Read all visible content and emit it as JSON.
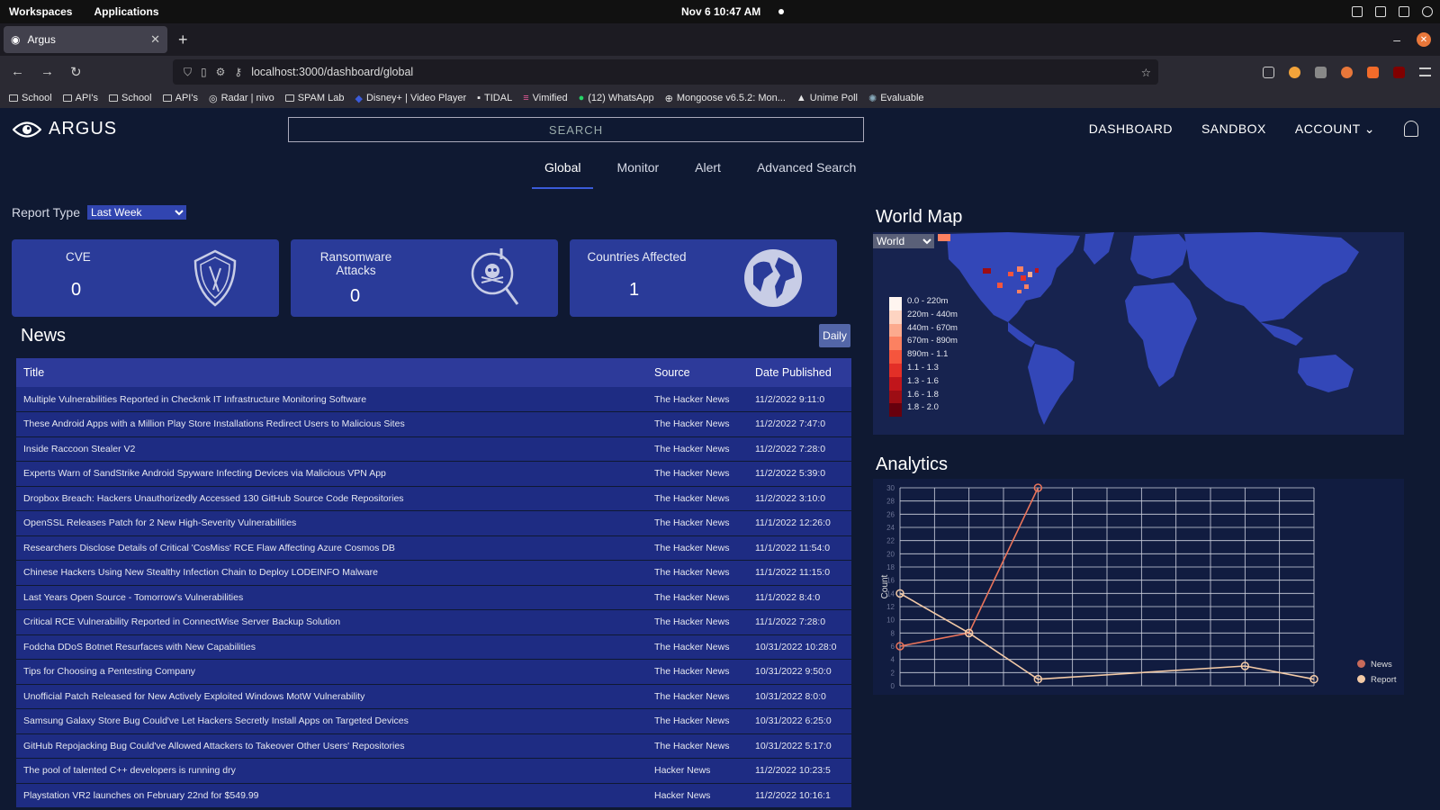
{
  "os": {
    "workspaces": "Workspaces",
    "applications": "Applications",
    "datetime": "Nov 6  10:47 AM"
  },
  "browser": {
    "tab_title": "Argus",
    "url": "localhost:3000/dashboard/global",
    "bookmarks": [
      "School",
      "API's",
      "School",
      "API's",
      "Radar | nivo",
      "SPAM Lab",
      "Disney+ | Video Player",
      "TIDAL",
      "Vimified",
      "(12) WhatsApp",
      "Mongoose v6.5.2: Mon...",
      "Unime Poll",
      "Evaluable"
    ]
  },
  "header": {
    "brand": "ARGUS",
    "search_placeholder": "SEARCH",
    "nav": {
      "dashboard": "DASHBOARD",
      "sandbox": "SANDBOX",
      "account": "ACCOUNT"
    }
  },
  "tabs": [
    "Global",
    "Monitor",
    "Alert",
    "Advanced Search"
  ],
  "report": {
    "label": "Report Type",
    "selected": "Last Week"
  },
  "cards": {
    "cve": {
      "label": "CVE",
      "value": "0"
    },
    "ransomware": {
      "label": "Ransomware Attacks",
      "value": "0"
    },
    "countries": {
      "label": "Countries Affected",
      "value": "1"
    }
  },
  "news": {
    "title": "News",
    "filter": "Daily",
    "columns": {
      "title": "Title",
      "source": "Source",
      "date": "Date Published"
    },
    "rows": [
      {
        "title": "Multiple Vulnerabilities Reported in Checkmk IT Infrastructure Monitoring Software",
        "source": "The Hacker News",
        "date": "11/2/2022 9:11:0"
      },
      {
        "title": "These Android Apps with a Million Play Store Installations Redirect Users to Malicious Sites",
        "source": "The Hacker News",
        "date": "11/2/2022 7:47:0"
      },
      {
        "title": "Inside Raccoon Stealer V2",
        "source": "The Hacker News",
        "date": "11/2/2022 7:28:0"
      },
      {
        "title": "Experts Warn of SandStrike Android Spyware Infecting Devices via Malicious VPN App",
        "source": "The Hacker News",
        "date": "11/2/2022 5:39:0"
      },
      {
        "title": "Dropbox Breach: Hackers Unauthorizedly Accessed 130 GitHub Source Code Repositories",
        "source": "The Hacker News",
        "date": "11/2/2022 3:10:0"
      },
      {
        "title": "OpenSSL Releases Patch for 2 New High-Severity Vulnerabilities",
        "source": "The Hacker News",
        "date": "11/1/2022 12:26:0"
      },
      {
        "title": "Researchers Disclose Details of Critical 'CosMiss' RCE Flaw Affecting Azure Cosmos DB",
        "source": "The Hacker News",
        "date": "11/1/2022 11:54:0"
      },
      {
        "title": "Chinese Hackers Using New Stealthy Infection Chain to Deploy LODEINFO Malware",
        "source": "The Hacker News",
        "date": "11/1/2022 11:15:0"
      },
      {
        "title": "Last Years Open Source - Tomorrow's Vulnerabilities",
        "source": "The Hacker News",
        "date": "11/1/2022 8:4:0"
      },
      {
        "title": "Critical RCE Vulnerability Reported in ConnectWise Server Backup Solution",
        "source": "The Hacker News",
        "date": "11/1/2022 7:28:0"
      },
      {
        "title": "Fodcha DDoS Botnet Resurfaces with New Capabilities",
        "source": "The Hacker News",
        "date": "10/31/2022 10:28:0"
      },
      {
        "title": "Tips for Choosing a Pentesting Company",
        "source": "The Hacker News",
        "date": "10/31/2022 9:50:0"
      },
      {
        "title": "Unofficial Patch Released for New Actively Exploited Windows MotW Vulnerability",
        "source": "The Hacker News",
        "date": "10/31/2022 8:0:0"
      },
      {
        "title": "Samsung Galaxy Store Bug Could've Let Hackers Secretly Install Apps on Targeted Devices",
        "source": "The Hacker News",
        "date": "10/31/2022 6:25:0"
      },
      {
        "title": "GitHub Repojacking Bug Could've Allowed Attackers to Takeover Other Users' Repositories",
        "source": "The Hacker News",
        "date": "10/31/2022 5:17:0"
      },
      {
        "title": "The pool of talented C++ developers is running dry",
        "source": "Hacker News",
        "date": "11/2/2022 10:23:5"
      },
      {
        "title": "Playstation VR2 launches on February 22nd for $549.99",
        "source": "Hacker News",
        "date": "11/2/2022 10:16:1"
      }
    ]
  },
  "world_map": {
    "title": "World Map",
    "selected_region": "World",
    "legend": [
      "0.0 - 220m",
      "220m - 440m",
      "440m - 670m",
      "670m - 890m",
      "890m - 1.1",
      "1.1 - 1.3",
      "1.3 - 1.6",
      "1.6 - 1.8",
      "1.8 - 2.0"
    ],
    "legend_colors": [
      "#fff5f0",
      "#fdd4c2",
      "#fcaa8e",
      "#fc8161",
      "#f5553d",
      "#e32f27",
      "#c1151b",
      "#9d0d14",
      "#67000d"
    ],
    "land_color": "#3347b8"
  },
  "analytics": {
    "title": "Analytics",
    "legend": {
      "news": "News",
      "report": "Report"
    },
    "chart_data": {
      "type": "line",
      "x": [
        0,
        1,
        2,
        3,
        4,
        5,
        6
      ],
      "ylabel": "Count",
      "ylim": [
        0,
        30
      ],
      "yticks": [
        0,
        2,
        4,
        6,
        8,
        10,
        12,
        14,
        16,
        18,
        20,
        22,
        24,
        26,
        28,
        30
      ],
      "grid": true,
      "legend_position": "bottom-right",
      "series": [
        {
          "name": "News",
          "color": "#e8735a",
          "values": [
            6,
            8,
            30,
            null,
            null,
            null,
            null
          ]
        },
        {
          "name": "Report",
          "color": "#f2c9a6",
          "values": [
            14,
            8,
            1,
            null,
            null,
            3,
            1
          ]
        }
      ]
    }
  }
}
